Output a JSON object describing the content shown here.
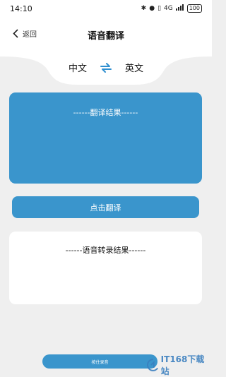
{
  "status_bar": {
    "time": "14:10",
    "battery": "100",
    "network": "4G"
  },
  "header": {
    "back_label": "返回",
    "title": "语音翻译"
  },
  "languages": {
    "source": "中文",
    "target": "英文"
  },
  "result": {
    "text": "------翻译结果------"
  },
  "translate_button": {
    "label": "点击翻译"
  },
  "transcription": {
    "text": "------语音转录结果------"
  },
  "record_button": {
    "label": "按住录音"
  },
  "watermark": {
    "text": "IT168下载站"
  },
  "colors": {
    "accent": "#3a95cc",
    "background": "#efefef",
    "card": "#ffffff"
  }
}
